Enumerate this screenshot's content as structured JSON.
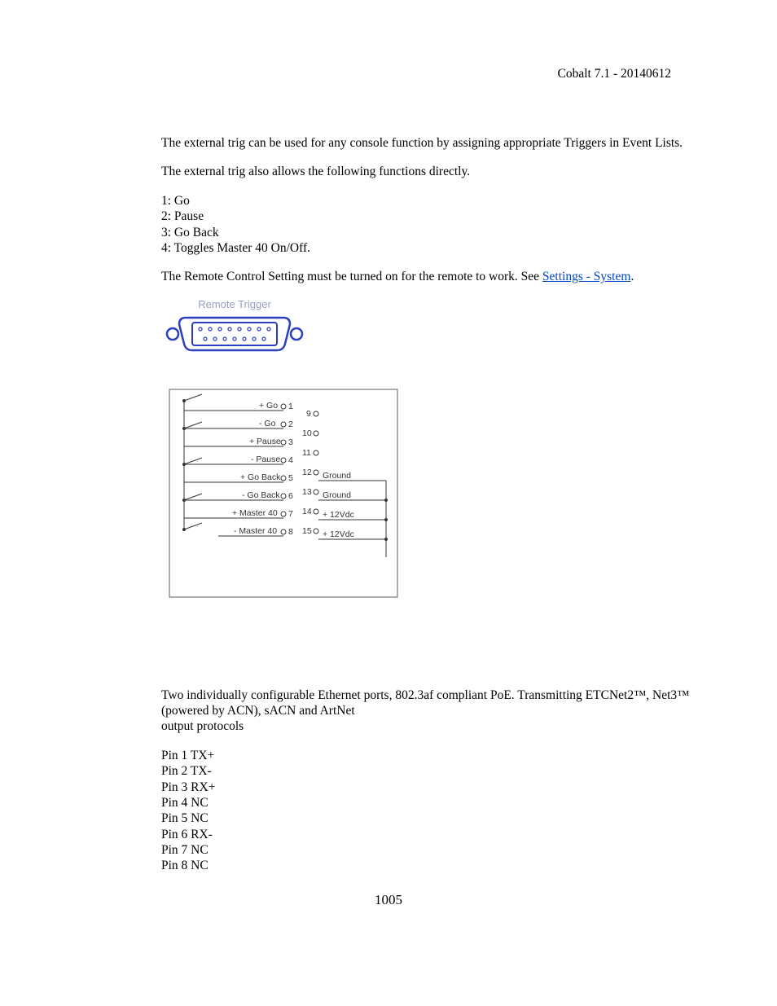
{
  "header": {
    "right": "Cobalt 7.1 - 20140612"
  },
  "paras": {
    "p1": "The external trig can be used for any console function by assigning appropriate Triggers in Event Lists.",
    "p2": "The external trig also allows the following functions directly.",
    "p3a": "The Remote Control Setting must be turned on for the remote to work. See ",
    "p3link": "Settings - System",
    "p3b": ".",
    "p4": "Two individually configurable Ethernet ports, 802.3af compliant PoE. Transmitting ETCNet2™, Net3™ (powered by ACN), sACN and ArtNet",
    "p4b": "output protocols"
  },
  "funcs": {
    "i1": "1: Go",
    "i2": "2: Pause",
    "i3": "3: Go Back",
    "i4": "4: Toggles Master 40 On/Off."
  },
  "pins": {
    "i1": "Pin 1 TX+",
    "i2": "Pin 2 TX-",
    "i3": "Pin 3 RX+",
    "i4": "Pin 4 NC",
    "i5": "Pin 5 NC",
    "i6": "Pin 6 RX-",
    "i7": "Pin 7 NC",
    "i8": "Pin 8 NC"
  },
  "diagram1": {
    "title": "Remote Trigger"
  },
  "diagram2": {
    "left_rows": [
      {
        "label": "+ Go",
        "pin": "1"
      },
      {
        "label": "- Go",
        "pin": "2"
      },
      {
        "label": "+ Pause",
        "pin": "3"
      },
      {
        "label": "- Pause",
        "pin": "4"
      },
      {
        "label": "+ Go Back",
        "pin": "5"
      },
      {
        "label": "- Go Back",
        "pin": "6"
      },
      {
        "label": "+ Master 40",
        "pin": "7"
      },
      {
        "label": "- Master 40",
        "pin": "8"
      }
    ],
    "right_rows": [
      {
        "pin": "9",
        "label": ""
      },
      {
        "pin": "10",
        "label": ""
      },
      {
        "pin": "11",
        "label": ""
      },
      {
        "pin": "12",
        "label": "Ground"
      },
      {
        "pin": "13",
        "label": "Ground"
      },
      {
        "pin": "14",
        "label": "+ 12Vdc"
      },
      {
        "pin": "15",
        "label": "+ 12Vdc"
      }
    ]
  },
  "page_number": "1005"
}
